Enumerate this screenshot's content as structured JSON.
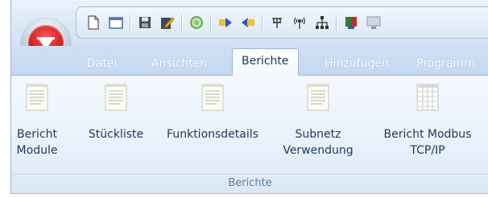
{
  "app_menu": {
    "icon": "app-orb-icon"
  },
  "quick_access": [
    {
      "icon": "new-file-icon"
    },
    {
      "icon": "open-window-icon"
    },
    {
      "icon": "save-icon"
    },
    {
      "icon": "edit-icon"
    },
    {
      "icon": "refresh-icon"
    },
    {
      "icon": "arrow-right-icon"
    },
    {
      "icon": "arrow-left-icon"
    },
    {
      "icon": "connection-icon"
    },
    {
      "icon": "antenna-icon"
    },
    {
      "icon": "network-icon"
    },
    {
      "icon": "chip-icon"
    },
    {
      "icon": "monitor-icon"
    }
  ],
  "tabs": [
    {
      "label": "Datei",
      "active": false
    },
    {
      "label": "Ansichten",
      "active": false
    },
    {
      "label": "Berichte",
      "active": true
    },
    {
      "label": "Hinzufügen",
      "active": false
    },
    {
      "label": "Programm",
      "active": false
    }
  ],
  "ribbon": {
    "group_label": "Berichte",
    "buttons": [
      {
        "label": "Bericht\nModule",
        "icon": "document-icon"
      },
      {
        "label": "Stückliste",
        "icon": "document-icon"
      },
      {
        "label": "Funktionsdetails",
        "icon": "document-icon"
      },
      {
        "label": "Subnetz\nVerwendung",
        "icon": "document-icon"
      },
      {
        "label": "Bericht Modbus\nTCP/IP",
        "icon": "table-document-icon"
      }
    ]
  },
  "colors": {
    "accent_red": "#d81e1e",
    "ribbon_text": "#1e395b",
    "group_text": "#5f7ea6"
  }
}
